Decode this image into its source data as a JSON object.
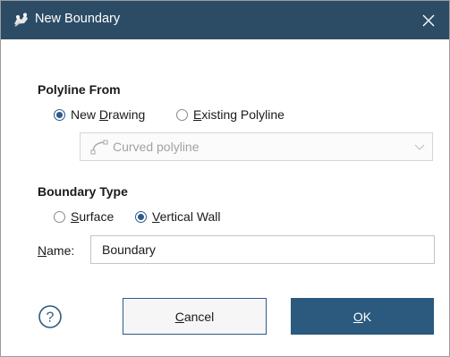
{
  "dialog": {
    "title": "New Boundary",
    "close_glyph": "✕"
  },
  "polyline_from": {
    "label": "Polyline From",
    "options": [
      {
        "mnemonic_pre": "New ",
        "mnemonic": "D",
        "mnemonic_post": "rawing",
        "checked": true
      },
      {
        "mnemonic_pre": "",
        "mnemonic": "E",
        "mnemonic_post": "xisting Polyline",
        "checked": false
      }
    ],
    "dropdown": {
      "value": "Curved polyline",
      "enabled": false,
      "icon": "curved-polyline-icon"
    }
  },
  "boundary_type": {
    "label": "Boundary Type",
    "options": [
      {
        "mnemonic_pre": "",
        "mnemonic": "S",
        "mnemonic_post": "urface",
        "checked": false
      },
      {
        "mnemonic_pre": "",
        "mnemonic": "V",
        "mnemonic_post": "ertical Wall",
        "checked": true
      }
    ]
  },
  "name": {
    "label_mnemonic": "N",
    "label_rest": "ame:",
    "value": "Boundary"
  },
  "buttons": {
    "help_glyph": "?",
    "cancel_mnemonic": "C",
    "cancel_rest": "ancel",
    "ok_mnemonic": "O",
    "ok_rest": "K"
  },
  "colors": {
    "titlebar": "#2c4c66",
    "accent": "#2c5a7e"
  }
}
